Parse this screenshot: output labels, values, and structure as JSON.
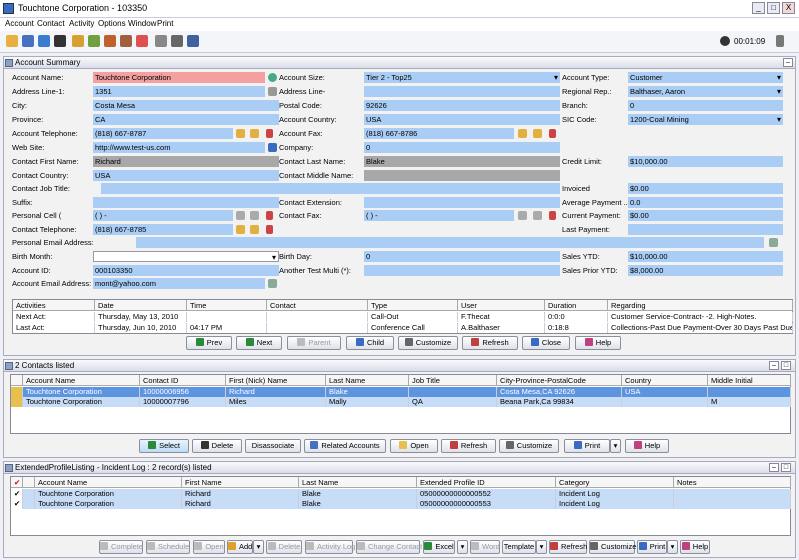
{
  "window": {
    "title": "Touchtone Corporation - 103350",
    "min": "_",
    "max": "□",
    "close": "X"
  },
  "menu": [
    "Account",
    "Contact",
    "Activity",
    "Options",
    "Window",
    "Print"
  ],
  "clock": "00:01:09",
  "summary": {
    "title": "Account Summary",
    "col1": [
      {
        "label": "Account Name:",
        "value": "Touchtone Corporation"
      },
      {
        "label": "Address Line-1:",
        "value": "1351"
      },
      {
        "label": "City:",
        "value": "Costa Mesa"
      },
      {
        "label": "Province:",
        "value": "CA"
      },
      {
        "label": "Account Telephone:",
        "value": "(818) 667-8787"
      },
      {
        "label": "Web Site:",
        "value": "http://www.test-us.com"
      },
      {
        "label": "Contact First Name:",
        "value": "Richard"
      },
      {
        "label": "Contact Country:",
        "value": "USA"
      },
      {
        "label": "Contact Job Title:",
        "value": ""
      },
      {
        "label": "Suffix:",
        "value": ""
      },
      {
        "label": "Personal Cell (",
        "value": "(   )   -"
      },
      {
        "label": "Contact Telephone:",
        "value": "(818) 667-8785"
      },
      {
        "label": "Personal Email Address:",
        "value": ""
      },
      {
        "label": "Birth Month:",
        "value": ""
      },
      {
        "label": "Account ID:",
        "value": "000103350"
      },
      {
        "label": "Account Email Address:",
        "value": "mont@yahoo.com"
      }
    ],
    "col2": [
      {
        "label": "Account Size:",
        "value": "Tier 2 - Top25"
      },
      {
        "label": "Address Line-",
        "value": ""
      },
      {
        "label": "Postal Code:",
        "value": "92626"
      },
      {
        "label": "Account Country:",
        "value": "USA"
      },
      {
        "label": "Account Fax:",
        "value": "(818) 667-8786"
      },
      {
        "label": "Company:",
        "value": "0"
      },
      {
        "label": "Contact Last Name:",
        "value": "Blake"
      },
      {
        "label": "Contact Middle Name:",
        "value": ""
      },
      {
        "label": "Contact Extension:",
        "value": ""
      },
      {
        "label": "Contact Fax:",
        "value": "(   )   -"
      },
      {
        "label": "Birth Day:",
        "value": "0"
      },
      {
        "label": "Another Test Multi (*):",
        "value": ""
      }
    ],
    "col3": [
      {
        "label": "Account Type:",
        "value": "Customer"
      },
      {
        "label": "Regional Rep.:",
        "value": "Balthaser, Aaron"
      },
      {
        "label": "Branch:",
        "value": "0"
      },
      {
        "label": "SIC Code:",
        "value": "1200-Coal Mining"
      },
      {
        "label": "Credit Limit:",
        "value": "$10,000.00"
      },
      {
        "label": "Invoiced",
        "value": "$0.00"
      },
      {
        "label": "Average Payment ...",
        "value": "0.0"
      },
      {
        "label": "Current Payment:",
        "value": "$0.00"
      },
      {
        "label": "Last Payment:",
        "value": ""
      },
      {
        "label": "Sales YTD:",
        "value": "$10,000.00"
      },
      {
        "label": "Sales Prior YTD:",
        "value": "$8,000.00"
      }
    ]
  },
  "activities": {
    "headers": [
      "Activities",
      "Date",
      "Time",
      "Contact",
      "Type",
      "User",
      "Duration",
      "Regarding"
    ],
    "rows": [
      [
        "Next Act:",
        "Thursday, May 13, 2010",
        "",
        "",
        "Call-Out",
        "F.Thecat",
        "0:0:0",
        "Customer Service-Contract- -2. High-Notes."
      ],
      [
        "Last Act:",
        "Thursday, Jun 10, 2010",
        "04:17 PM",
        "",
        "Conference Call",
        "A.Balthaser",
        "0:18:8",
        "Collections-Past Due Payment-Over 30 Days Past Due- -"
      ]
    ]
  },
  "summary_buttons": [
    "Prev",
    "Next",
    "Parent",
    "Child",
    "Customize",
    "Refresh",
    "Close",
    "Help"
  ],
  "contacts": {
    "title": "2 Contacts listed",
    "headers": [
      "Account Name",
      "Contact ID",
      "First (Nick) Name",
      "Last Name",
      "Job Title",
      "City-Province-PostalCode",
      "Country",
      "Middle Initial"
    ],
    "rows": [
      [
        "Touchtone Corporation",
        "10000006956",
        "Richard",
        "Blake",
        "",
        "Costa Mesa,CA 92626",
        "USA",
        ""
      ],
      [
        "Touchtone Corporation",
        "10000007796",
        "Miles",
        "Mally",
        "QA",
        "Beana Park,Ca 99834",
        "",
        "M"
      ]
    ],
    "buttons": [
      "Select",
      "Delete",
      "Disassociate",
      "Related Accounts",
      "Open",
      "Refresh",
      "Customize",
      "Print",
      "Help"
    ]
  },
  "incidents": {
    "title": "ExtendedProfileListing - Incident Log : 2 record(s) listed",
    "headers": [
      "Account Name",
      "First Name",
      "Last Name",
      "Extended Profile ID",
      "Category",
      "Notes"
    ],
    "rows": [
      [
        "Touchtone Corporation",
        "Richard",
        "Blake",
        "05000000000000552",
        "Incident Log",
        ""
      ],
      [
        "Touchtone Corporation",
        "Richard",
        "Blake",
        "05000000000000553",
        "Incident Log",
        ""
      ]
    ],
    "buttons": [
      "Complete",
      "Schedule",
      "Open",
      "Add",
      "Delete",
      "Activity Log",
      "Change Contact",
      "Excel",
      "Word",
      "Template",
      "Refresh",
      "Customize",
      "Print",
      "Help"
    ]
  }
}
